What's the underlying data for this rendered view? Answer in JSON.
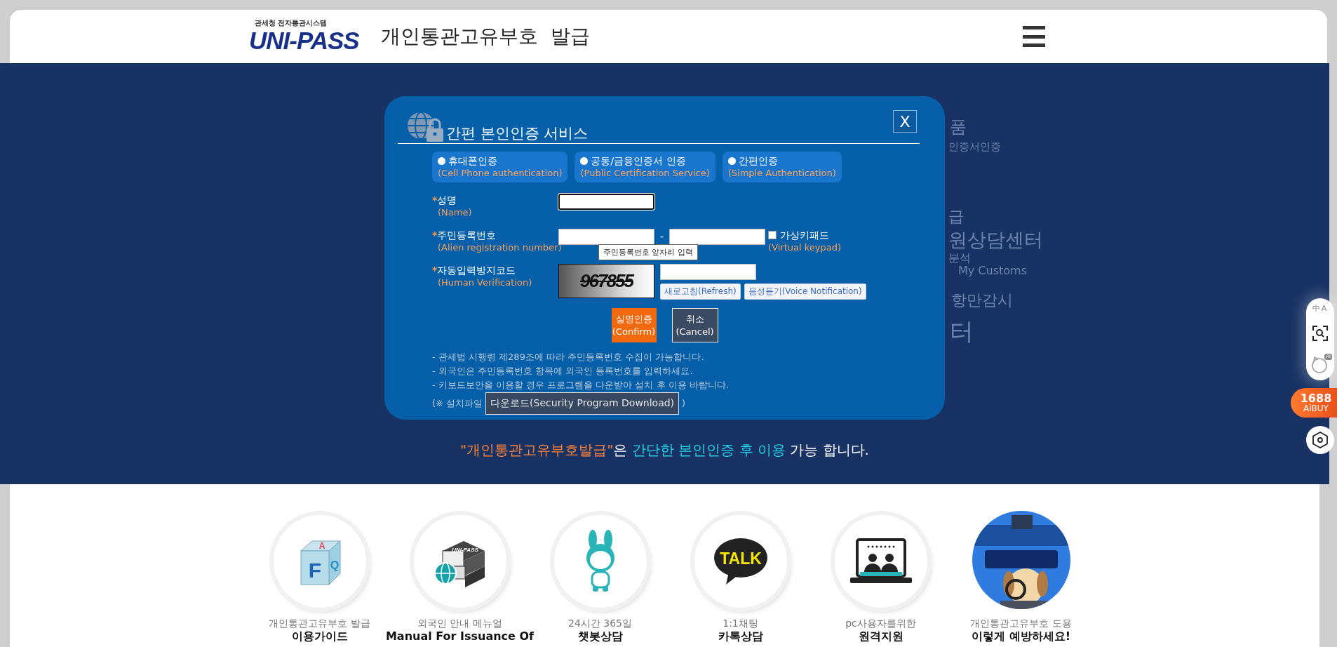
{
  "header": {
    "logo_caption": "관세청 전자통관시스템",
    "logo_text": "UNI-PASS",
    "title": "개인통관고유부호  발급"
  },
  "modal": {
    "title": "간편 본인인증 서비스",
    "close_label": "X",
    "required_mark": "*",
    "auth_methods": [
      {
        "label": "휴대폰인증",
        "sublabel": "(Cell Phone authentication)",
        "selected": false
      },
      {
        "label": "공동/금융인증서 인증",
        "sublabel": "(Public Certification Service)",
        "selected": false
      },
      {
        "label": "간편인증",
        "sublabel": "(Simple Authentication)",
        "selected": false
      }
    ],
    "fields": [
      {
        "kind": "name",
        "label": "성명",
        "sublabel": "(Name)",
        "required": true,
        "focused": true
      },
      {
        "kind": "id",
        "label": "주민등록번호",
        "sublabel": "(Alien registration number)",
        "required": true,
        "separator": "-",
        "tooltip": "주민등록번호 앞자리 입력",
        "keypad": {
          "label": "가상키패드",
          "sublabel": "(Virtual keypad)",
          "checked": false
        }
      },
      {
        "kind": "captcha",
        "label": "자동입력방지코드",
        "sublabel": "(Human Verification)",
        "required": true,
        "captcha_text": "967855",
        "buttons": [
          "새로고침(Refresh)",
          "음성듣기(Voice Notification)"
        ]
      }
    ],
    "actions": [
      {
        "kind": "primary",
        "label": "실명인증",
        "sublabel": "(Confirm)"
      },
      {
        "kind": "secondary",
        "label": "취소",
        "sublabel": "(Cancel)"
      }
    ],
    "notes": [
      "- 관세법 시행령 제289조에 따라 주민등록번호 수집이 가능합니다.",
      "- 외국인은 주민등록번호 항목에 외국인 등록번호를 입력하세요.",
      "- 키보드보안을 이용할 경우 프로그램을 다운받아 설치 후 이용 바랍니다."
    ],
    "download": {
      "prefix": "(※ 설치파일",
      "button": "다운로드(Security Program Download)",
      "suffix": ")"
    }
  },
  "notice": [
    {
      "text": "\"개인통관고유부호발급\"",
      "color": "#f7813a"
    },
    {
      "text": "은 ",
      "color": "#ffffff"
    },
    {
      "text": "간단한 본인인증 후 이용",
      "color": "#22d3e8"
    },
    {
      "text": " 가능 합니다.",
      "color": "#ffffff"
    }
  ],
  "background_text": [
    "품",
    "인증서인증",
    "급",
    "원상담센터",
    "분석",
    "My Customs",
    "항만감시",
    "터"
  ],
  "quick_menu": [
    {
      "kind": "faq",
      "caption": "개인통관고유부호 발급",
      "title": "이용가이드",
      "icon_letters": [
        "F",
        "Q",
        "A"
      ]
    },
    {
      "kind": "manual",
      "caption": "외국인 안내 메뉴얼",
      "title": "Manual For Issuance Of",
      "icon_label": "UNI-PASS"
    },
    {
      "kind": "chatbot",
      "caption": "24시간 365일",
      "title": "챗봇상담"
    },
    {
      "kind": "talk",
      "caption": "1:1채팅",
      "title": "카톡상담",
      "icon_label": "TALK"
    },
    {
      "kind": "remote",
      "caption": "pc사용자를위한",
      "title": "원격지원"
    },
    {
      "kind": "poster",
      "caption": "개인통관고유부호 도용",
      "title": "이렇게 예방하세요!"
    }
  ],
  "extension_bar": {
    "translate_glyphs": [
      "中",
      "A"
    ],
    "ai_badge": "AI",
    "brand_number": "1688",
    "brand_name": "AiBUY"
  }
}
